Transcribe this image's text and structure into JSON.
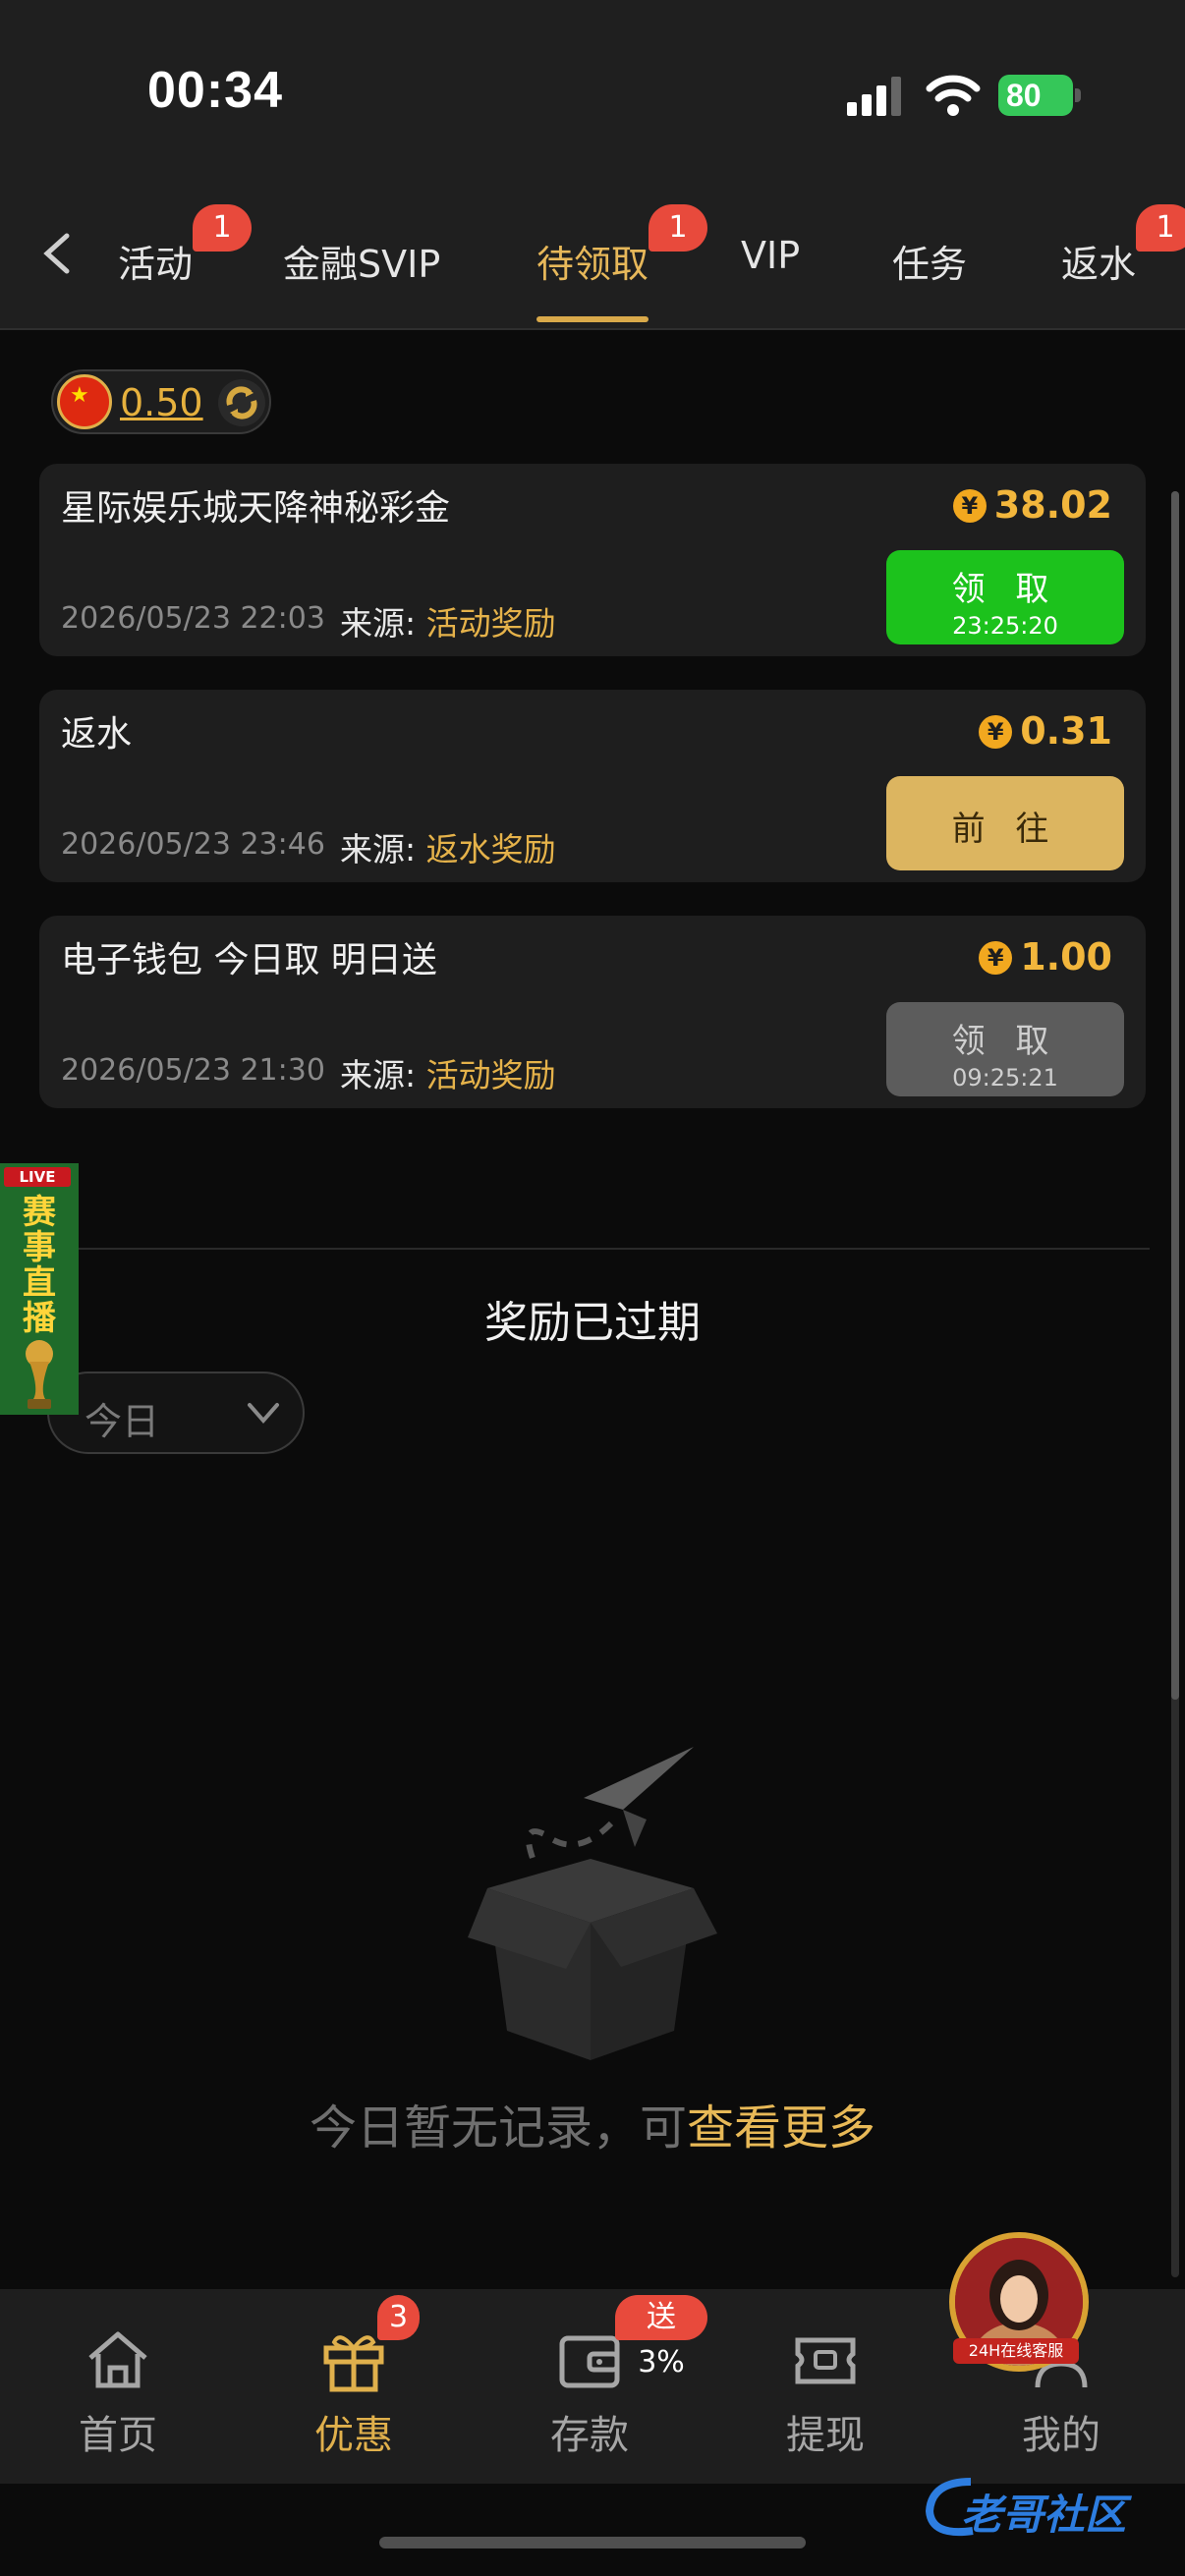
{
  "status_bar": {
    "time": "00:34",
    "battery": "80"
  },
  "tabs": [
    {
      "label": "活动",
      "badge": "1"
    },
    {
      "label": "金融SVIP"
    },
    {
      "label": "待领取",
      "badge": "1",
      "active": true
    },
    {
      "label": "VIP"
    },
    {
      "label": "任务"
    },
    {
      "label": "返水",
      "badge": "1"
    }
  ],
  "balance": {
    "value": "0.50"
  },
  "rewards": [
    {
      "title": "星际娱乐城天降神秘彩金",
      "amount": "38.02",
      "date": "2026/05/23 22:03",
      "source_label": "来源:",
      "source": "活动奖励",
      "button": "领 取",
      "timer": "23:25:20",
      "button_state": "claimable"
    },
    {
      "title": "返水",
      "amount": "0.31",
      "date": "2026/05/23 23:46",
      "source_label": "来源:",
      "source": "返水奖励",
      "button": "前 往",
      "button_state": "go"
    },
    {
      "title": "电子钱包 今日取 明日送",
      "amount": "1.00",
      "date": "2026/05/23 21:30",
      "source_label": "来源:",
      "source": "活动奖励",
      "button": "领 取",
      "timer": "09:25:21",
      "button_state": "disabled"
    }
  ],
  "expired": {
    "title": "奖励已过期",
    "filter_value": "今日"
  },
  "live_banner": {
    "tag": "LIVE",
    "text": "赛事直播"
  },
  "empty_state": {
    "text": "今日暂无记录，可",
    "link": "查看更多"
  },
  "bottom_nav": [
    {
      "label": "首页",
      "icon": "home-icon"
    },
    {
      "label": "优惠",
      "icon": "gift-icon",
      "badge": "3",
      "active": true
    },
    {
      "label": "存款",
      "icon": "wallet-icon",
      "badge": "送3%"
    },
    {
      "label": "提现",
      "icon": "ticket-icon"
    },
    {
      "label": "我的",
      "icon": "user-icon"
    }
  ],
  "customer_service": {
    "label": "24H在线客服"
  },
  "watermark": {
    "text": "老哥社区"
  },
  "colors": {
    "accent_gold": "#e7b85a",
    "claim_green": "#1cc21c",
    "badge_red": "#e84a3c",
    "background": "#0b0b0b"
  }
}
